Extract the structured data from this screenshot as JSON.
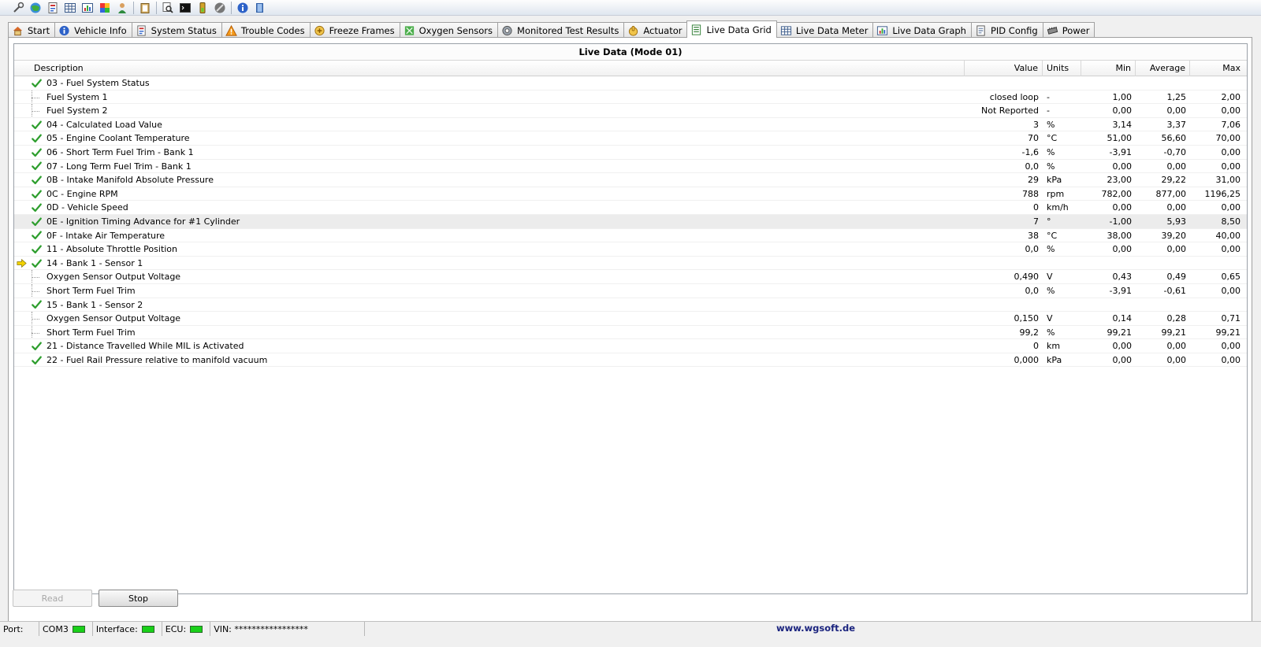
{
  "toolbar": {
    "icons": [
      "wrench-icon",
      "globe-icon",
      "report-icon",
      "grid-icon",
      "chart-icon",
      "colors-icon",
      "user-icon",
      "clipboard-icon",
      "search-icon",
      "terminal-icon",
      "battery-icon",
      "stop-icon",
      "info-icon",
      "book-icon"
    ]
  },
  "tabs": [
    {
      "label": "Start",
      "icon": "house-icon"
    },
    {
      "label": "Vehicle Info",
      "icon": "info-icon"
    },
    {
      "label": "System Status",
      "icon": "report-icon"
    },
    {
      "label": "Trouble Codes",
      "icon": "warning-icon"
    },
    {
      "label": "Freeze Frames",
      "icon": "freeze-icon"
    },
    {
      "label": "Oxygen Sensors",
      "icon": "sensor-icon"
    },
    {
      "label": "Monitored Test Results",
      "icon": "gear-icon"
    },
    {
      "label": "Actuator",
      "icon": "hand-icon"
    },
    {
      "label": "Live Data Grid",
      "icon": "list-icon",
      "active": true
    },
    {
      "label": "Live Data Meter",
      "icon": "grid-icon"
    },
    {
      "label": "Live Data Graph",
      "icon": "chart-icon"
    },
    {
      "label": "PID Config",
      "icon": "document-icon"
    },
    {
      "label": "Power",
      "icon": "chip-icon"
    }
  ],
  "grid": {
    "title": "Live Data (Mode 01)",
    "columns": {
      "description": "Description",
      "value": "Value",
      "units": "Units",
      "min": "Min",
      "average": "Average",
      "max": "Max"
    },
    "rows": [
      {
        "desc": "03 - Fuel System Status",
        "value": "",
        "units": "",
        "min": "",
        "avg": "",
        "max": "",
        "kind": "pid"
      },
      {
        "desc": "Fuel System 1",
        "value": "closed loop",
        "units": "-",
        "min": "1,00",
        "avg": "1,25",
        "max": "2,00",
        "kind": "child"
      },
      {
        "desc": "Fuel System 2",
        "value": "Not Reported",
        "units": "-",
        "min": "0,00",
        "avg": "0,00",
        "max": "0,00",
        "kind": "child"
      },
      {
        "desc": "04 - Calculated Load Value",
        "value": "3",
        "units": "%",
        "min": "3,14",
        "avg": "3,37",
        "max": "7,06",
        "kind": "pid"
      },
      {
        "desc": "05 - Engine Coolant Temperature",
        "value": "70",
        "units": "°C",
        "min": "51,00",
        "avg": "56,60",
        "max": "70,00",
        "kind": "pid"
      },
      {
        "desc": "06 - Short Term Fuel Trim - Bank 1",
        "value": "-1,6",
        "units": "%",
        "min": "-3,91",
        "avg": "-0,70",
        "max": "0,00",
        "kind": "pid"
      },
      {
        "desc": "07 - Long Term Fuel Trim - Bank 1",
        "value": "0,0",
        "units": "%",
        "min": "0,00",
        "avg": "0,00",
        "max": "0,00",
        "kind": "pid"
      },
      {
        "desc": "0B - Intake Manifold Absolute Pressure",
        "value": "29",
        "units": "kPa",
        "min": "23,00",
        "avg": "29,22",
        "max": "31,00",
        "kind": "pid"
      },
      {
        "desc": "0C - Engine RPM",
        "value": "788",
        "units": "rpm",
        "min": "782,00",
        "avg": "877,00",
        "max": "1196,25",
        "kind": "pid"
      },
      {
        "desc": "0D - Vehicle Speed",
        "value": "0",
        "units": "km/h",
        "min": "0,00",
        "avg": "0,00",
        "max": "0,00",
        "kind": "pid"
      },
      {
        "desc": "0E - Ignition Timing Advance for #1 Cylinder",
        "value": "7",
        "units": "°",
        "min": "-1,00",
        "avg": "5,93",
        "max": "8,50",
        "kind": "pid",
        "selected": true
      },
      {
        "desc": "0F - Intake Air Temperature",
        "value": "38",
        "units": "°C",
        "min": "38,00",
        "avg": "39,20",
        "max": "40,00",
        "kind": "pid"
      },
      {
        "desc": "11 - Absolute Throttle Position",
        "value": "0,0",
        "units": "%",
        "min": "0,00",
        "avg": "0,00",
        "max": "0,00",
        "kind": "pid"
      },
      {
        "desc": "14 - Bank 1 - Sensor 1",
        "value": "",
        "units": "",
        "min": "",
        "avg": "",
        "max": "",
        "kind": "pid",
        "arrow": true
      },
      {
        "desc": "Oxygen Sensor Output Voltage",
        "value": "0,490",
        "units": "V",
        "min": "0,43",
        "avg": "0,49",
        "max": "0,65",
        "kind": "child"
      },
      {
        "desc": "Short Term Fuel Trim",
        "value": "0,0",
        "units": "%",
        "min": "-3,91",
        "avg": "-0,61",
        "max": "0,00",
        "kind": "child"
      },
      {
        "desc": "15 - Bank 1 - Sensor 2",
        "value": "",
        "units": "",
        "min": "",
        "avg": "",
        "max": "",
        "kind": "pid"
      },
      {
        "desc": "Oxygen Sensor Output Voltage",
        "value": "0,150",
        "units": "V",
        "min": "0,14",
        "avg": "0,28",
        "max": "0,71",
        "kind": "child"
      },
      {
        "desc": "Short Term Fuel Trim",
        "value": "99,2",
        "units": "%",
        "min": "99,21",
        "avg": "99,21",
        "max": "99,21",
        "kind": "child"
      },
      {
        "desc": "21 - Distance Travelled While MIL is Activated",
        "value": "0",
        "units": "km",
        "min": "0,00",
        "avg": "0,00",
        "max": "0,00",
        "kind": "pid"
      },
      {
        "desc": "22 - Fuel Rail Pressure relative to manifold vacuum",
        "value": "0,000",
        "units": "kPa",
        "min": "0,00",
        "avg": "0,00",
        "max": "0,00",
        "kind": "pid"
      }
    ]
  },
  "buttons": {
    "read": "Read",
    "stop": "Stop"
  },
  "status": {
    "port_label": "Port:",
    "port_value": "COM3",
    "interface_label": "Interface:",
    "ecu_label": "ECU:",
    "vin_label": "VIN:",
    "vin_value": "*****************",
    "website": "www.wgsoft.de"
  },
  "colors": {
    "check": "#2e9e2e",
    "arrow": "#f2d200",
    "led": "#19d019"
  }
}
